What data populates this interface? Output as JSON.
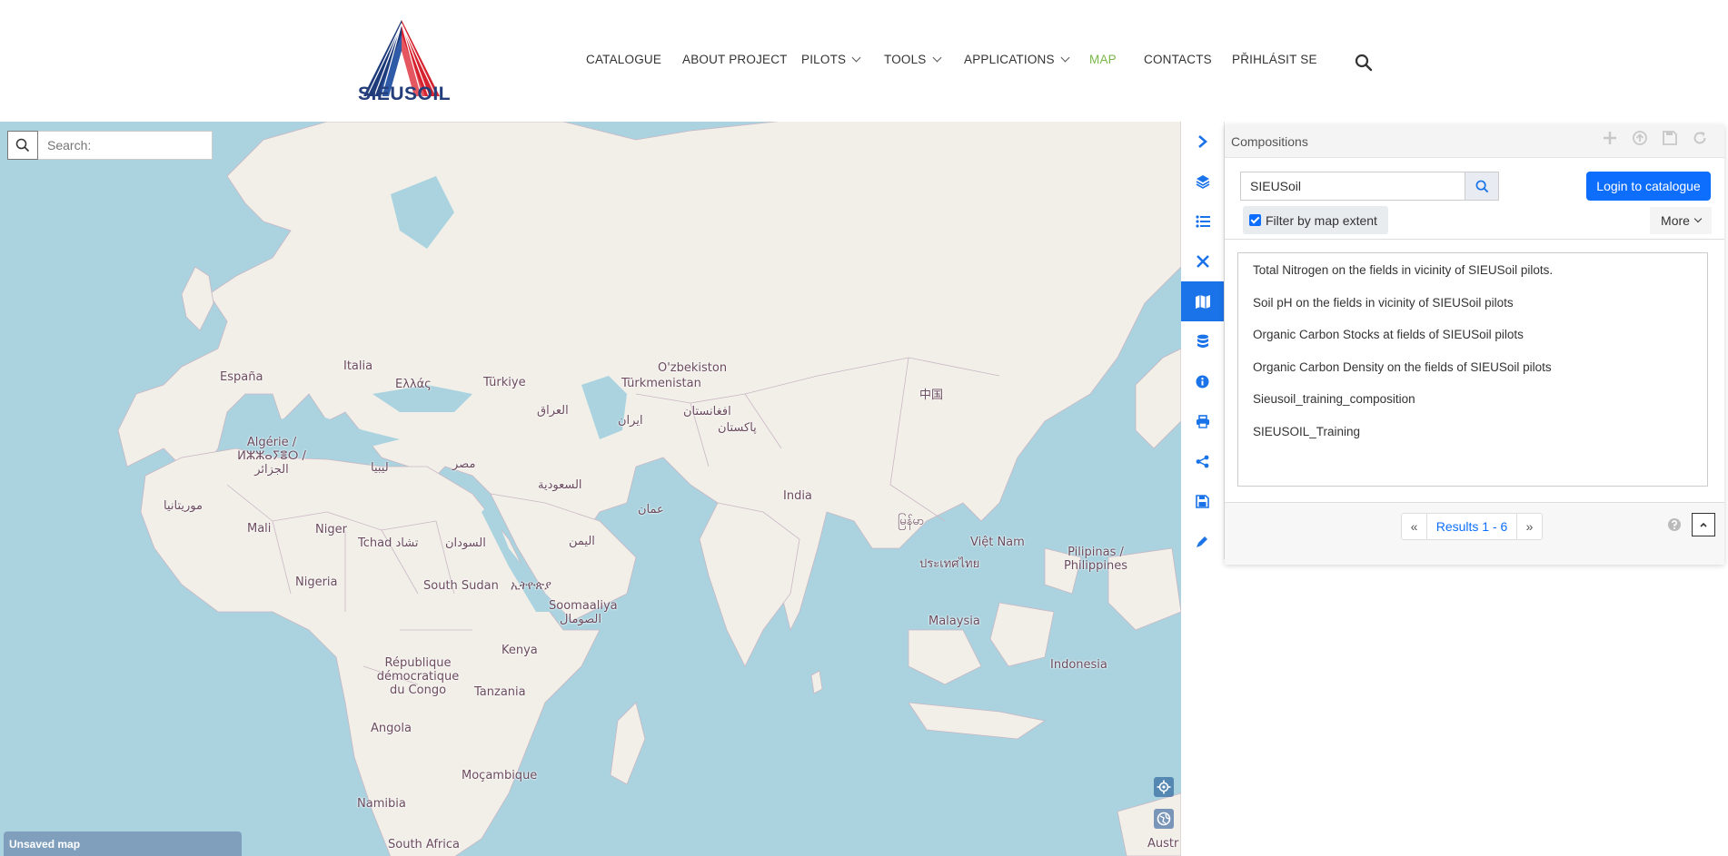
{
  "header": {
    "logo_text": "SIEUSOIL",
    "nav": [
      {
        "label": "CATALOGUE",
        "dropdown": false,
        "active": false
      },
      {
        "label": "ABOUT PROJECT",
        "dropdown": false,
        "active": false
      },
      {
        "label": "PILOTS",
        "dropdown": true,
        "active": false
      },
      {
        "label": "TOOLS",
        "dropdown": true,
        "active": false
      },
      {
        "label": "APPLICATIONS",
        "dropdown": true,
        "active": false
      },
      {
        "label": "MAP",
        "dropdown": false,
        "active": true
      },
      {
        "label": "CONTACTS",
        "dropdown": false,
        "active": false
      },
      {
        "label": "PŘIHLÁSIT SE",
        "dropdown": false,
        "active": false
      }
    ]
  },
  "map": {
    "search_placeholder": "Search:",
    "status": "Unsaved map",
    "labels": [
      "España",
      "Italia",
      "Ελλάς",
      "Türkiye",
      "O'zbekiston",
      "Türkmenistan",
      "中国",
      "ایران",
      "العراق",
      "افغانستان",
      "پاکستان",
      "Algérie / ⵍⵣⵣⴰⵢⴻⵔ / الجزائر",
      "ليبيا",
      "مصر",
      "السعودية",
      "عمان",
      "India",
      "موريتانيا",
      "Mali",
      "Niger",
      "Tchad تشاد",
      "السودان",
      "اليمن",
      "Nigeria",
      "South Sudan",
      "ኢትዮጵያ",
      "Soomaaliya الصومال",
      "မြန်မာ",
      "Việt Nam",
      "ประเทศไทย",
      "Pilipinas / Philippines",
      "Kenya",
      "République démocratique du Congo",
      "Tanzania",
      "Malaysia",
      "Indonesia",
      "Angola",
      "Moçambique",
      "Namibia",
      "South Africa",
      "Austr"
    ]
  },
  "sidebar": {
    "icons": [
      "chevron-right-icon",
      "layers-icon",
      "list-icon",
      "tools-icon",
      "map-icon",
      "database-icon",
      "info-icon",
      "print-icon",
      "share-icon",
      "save-icon",
      "draw-icon"
    ],
    "active_index": 4,
    "accent": "#1a73e8"
  },
  "panel": {
    "title": "Compositions",
    "query": "SIEUSoil",
    "login_label": "Login to catalogue",
    "filter_label": "Filter by map extent",
    "more_label": "More",
    "items": [
      "Total Nitrogen on the fields in vicinity of SIEUSoil pilots.",
      "Soil pH on the fields in vicinity of SIEUSoil pilots",
      "Organic Carbon Stocks at fields of SIEUSoil pilots",
      "Organic Carbon Density on the fields of SIEUSoil pilots",
      "Sieusoil_training_composition",
      "SIEUSOIL_Training"
    ],
    "pager": {
      "prev": "«",
      "label": "Results 1 - 6",
      "next": "»"
    }
  }
}
